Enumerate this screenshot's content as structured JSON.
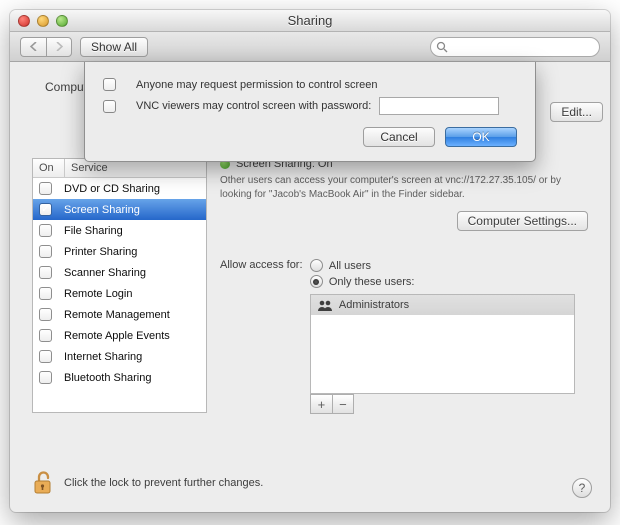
{
  "window_title": "Sharing",
  "toolbar": {
    "show_all": "Show All",
    "search_placeholder": ""
  },
  "computer_label": "Comput",
  "edit_button": "Edit...",
  "service_header": {
    "on": "On",
    "service": "Service"
  },
  "services": [
    {
      "checked": false,
      "label": "DVD or CD Sharing"
    },
    {
      "checked": true,
      "label": "Screen Sharing"
    },
    {
      "checked": false,
      "label": "File Sharing"
    },
    {
      "checked": false,
      "label": "Printer Sharing"
    },
    {
      "checked": false,
      "label": "Scanner Sharing"
    },
    {
      "checked": false,
      "label": "Remote Login"
    },
    {
      "checked": false,
      "label": "Remote Management"
    },
    {
      "checked": false,
      "label": "Remote Apple Events"
    },
    {
      "checked": false,
      "label": "Internet Sharing"
    },
    {
      "checked": false,
      "label": "Bluetooth Sharing"
    }
  ],
  "status_title": "Screen Sharing: On",
  "status_desc": "Other users can access your computer's screen at vnc://172.27.35.105/ or by looking for \"Jacob's MacBook Air\" in the Finder sidebar.",
  "computer_settings_btn": "Computer Settings...",
  "access_label": "Allow access for:",
  "access_all": "All users",
  "access_only": "Only these users:",
  "users": [
    "Administrators"
  ],
  "lock_text": "Click the lock to prevent further changes.",
  "help": "?",
  "sheet": {
    "opt1": "Anyone may request permission to control screen",
    "opt2": "VNC viewers may control screen with password:",
    "cancel": "Cancel",
    "ok": "OK"
  }
}
